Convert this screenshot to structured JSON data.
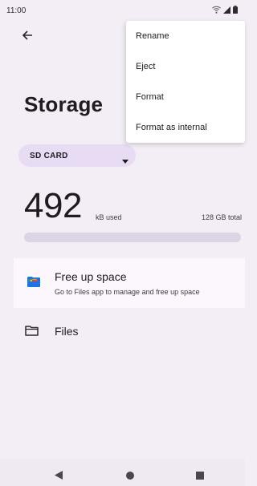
{
  "status_bar": {
    "time": "11:00"
  },
  "page": {
    "title": "Storage"
  },
  "volume_selector": {
    "selected": "SD CARD"
  },
  "usage": {
    "amount": "492",
    "unit": "kB used",
    "total": "128 GB total",
    "fraction_used": 0.0
  },
  "list": {
    "free_up": {
      "title": "Free up space",
      "subtitle": "Go to Files app to manage and free up space"
    },
    "files": {
      "label": "Files"
    }
  },
  "overflow_menu": {
    "items": [
      {
        "label": "Rename"
      },
      {
        "label": "Eject"
      },
      {
        "label": "Format"
      },
      {
        "label": "Format as internal"
      }
    ]
  },
  "icons": {
    "back": "arrow-left-icon",
    "dropdown": "chevron-down-icon",
    "files_app": "files-app-icon",
    "folder": "folder-icon",
    "wifi": "wifi-icon",
    "signal": "signal-icon",
    "battery": "battery-icon"
  },
  "colors": {
    "background": "#f3edf5",
    "chip": "#e7dcf4",
    "menu": "#ffffff",
    "usage_track": "#dcd4e2"
  }
}
